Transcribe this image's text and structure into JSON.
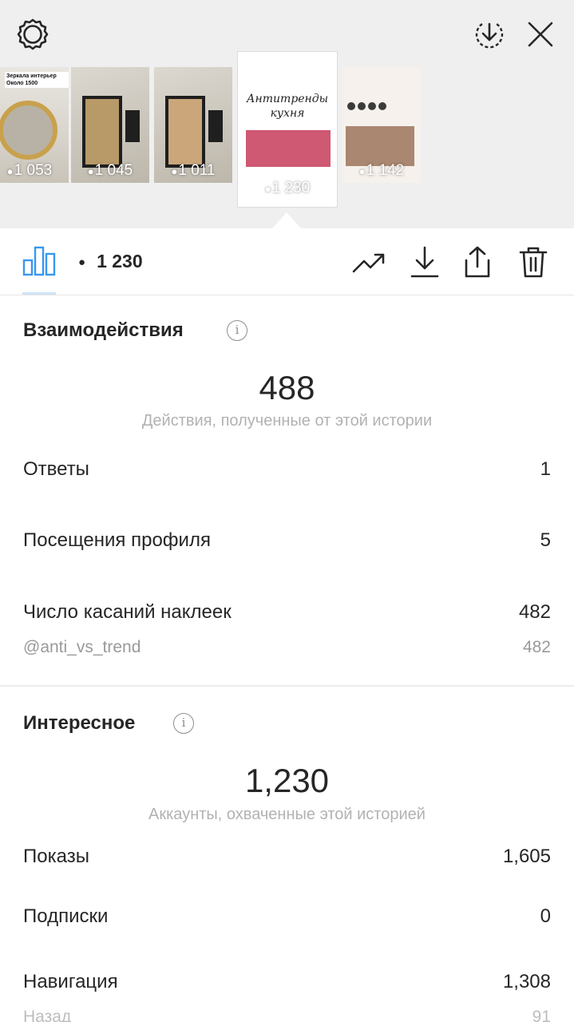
{
  "header": {
    "settings_icon": "gear-icon",
    "download_icon": "download-circle-icon",
    "close_icon": "close-icon"
  },
  "stories": [
    {
      "views": "1 053",
      "caption": "Зеркала интерьер Около 1500"
    },
    {
      "views": "1 045",
      "caption": ""
    },
    {
      "views": "1 011",
      "caption": ""
    },
    {
      "views": "1 230",
      "caption": "Антитренды кухня"
    },
    {
      "views": "1 142",
      "caption": ""
    }
  ],
  "toolbar": {
    "views": "1 230",
    "icons": [
      "bar-chart-icon",
      "eye-icon",
      "trend-icon",
      "download-icon",
      "share-icon",
      "trash-icon"
    ]
  },
  "interactions": {
    "title": "Взаимодействия",
    "total": "488",
    "caption": "Действия, полученные от этой истории",
    "rows": [
      {
        "label": "Ответы",
        "value": "1"
      },
      {
        "label": "Посещения профиля",
        "value": "5"
      },
      {
        "label": "Число касаний наклеек",
        "value": "482"
      }
    ],
    "sub": {
      "label": "@anti_vs_trend",
      "value": "482"
    }
  },
  "discovery": {
    "title": "Интересное",
    "total": "1,230",
    "caption": "Аккаунты, охваченные этой историей",
    "rows": [
      {
        "label": "Показы",
        "value": "1,605"
      },
      {
        "label": "Подписки",
        "value": "0"
      },
      {
        "label": "Навигация",
        "value": "1,308"
      }
    ],
    "sub": {
      "label": "Назад",
      "value": "91"
    }
  },
  "colors": {
    "accent": "#3897f0",
    "background_top": "#efefef",
    "text": "#262626",
    "muted": "#9a9a9a"
  }
}
